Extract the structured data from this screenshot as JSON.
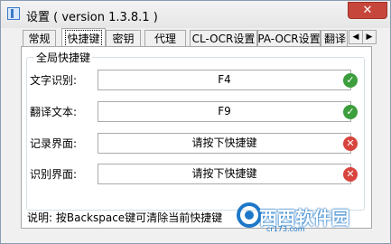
{
  "window": {
    "title": "设置 ( version 1.3.8.1 )",
    "minimize_glyph": "—",
    "maximize_glyph": "▢",
    "close_glyph": "✕"
  },
  "tabs": [
    {
      "label": "常规"
    },
    {
      "label": "快捷键",
      "active": true
    },
    {
      "label": "密钥"
    },
    {
      "label": "代理"
    },
    {
      "label": "CL-OCR设置"
    },
    {
      "label": "PA-OCR设置"
    },
    {
      "label": "翻译"
    }
  ],
  "tab_scroll": {
    "left": "◀",
    "right": "▶"
  },
  "hotkeys": {
    "group_title": "全局快捷键",
    "rows": [
      {
        "label": "文字识别:",
        "value": "F4",
        "status": "ok"
      },
      {
        "label": "翻译文本:",
        "value": "F9",
        "status": "ok"
      },
      {
        "label": "记录界面:",
        "value": "请按下快捷键",
        "status": "error"
      },
      {
        "label": "识别界面:",
        "value": "请按下快捷键",
        "status": "error"
      }
    ],
    "status_glyphs": {
      "ok": "✓",
      "error": "✕"
    }
  },
  "note": "说明: 按Backspace键可清除当前快捷键",
  "watermark": {
    "text": "西西软件园",
    "sub": "cr173.com"
  },
  "colors": {
    "ok": "#3c9e3c",
    "error": "#d8453e",
    "close_button": "#c7463b",
    "accent": "#1e78c8"
  }
}
